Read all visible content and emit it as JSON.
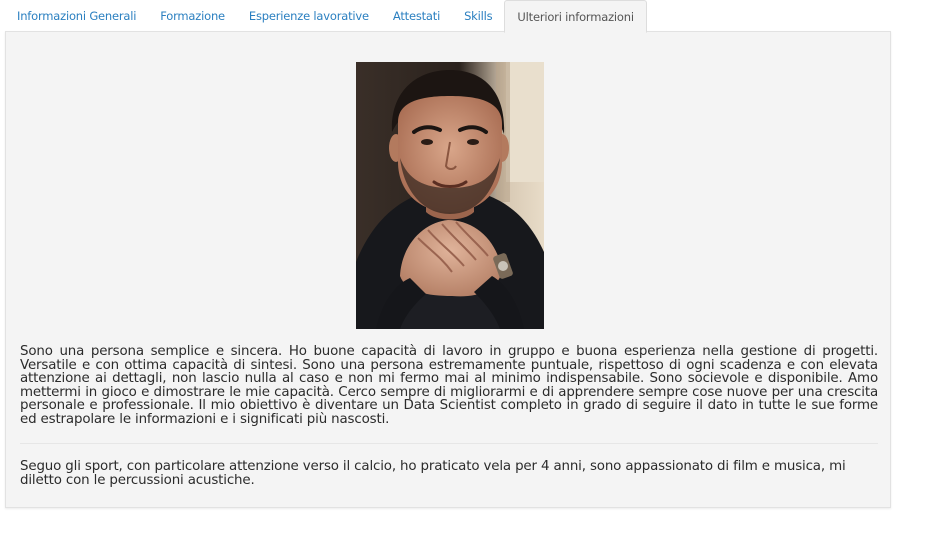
{
  "tabs": [
    {
      "label": "Informazioni Generali",
      "active": false
    },
    {
      "label": "Formazione",
      "active": false
    },
    {
      "label": "Esperienze lavorative",
      "active": false
    },
    {
      "label": "Attestati",
      "active": false
    },
    {
      "label": "Skills",
      "active": false
    },
    {
      "label": "Ulteriori informazioni",
      "active": true
    }
  ],
  "panel": {
    "about": "Sono una persona semplice e sincera. Ho buone capacità di lavoro in gruppo e buona esperienza nella gestione di progetti. Versatile e con ottima capacità di sintesi. Sono una persona estremamente puntuale, rispettoso di ogni scadenza e con elevata attenzione ai dettagli, non lascio nulla al caso e non mi fermo mai al minimo indispensabile. Sono socievole e disponibile. Amo mettermi in gioco e dimostrare le mie capacità. Cerco sempre di migliorarmi e di apprendere sempre cose nuove per una crescita personale e professionale. Il mio obiettivo è diventare un Data Scientist completo in grado di seguire il dato in tutte le sue forme ed estrapolare le informazioni e i significati più nascosti.",
    "interests": "Seguo gli sport, con particolare attenzione verso il calcio, ho praticato vela per 4 anni, sono appassionato di film e musica, mi diletto con le percussioni acustiche."
  },
  "colors": {
    "tab_link": "#2a7fc0",
    "tab_active_text": "#555555",
    "panel_bg": "#f4f4f4",
    "body_text": "#2b2b2b"
  }
}
